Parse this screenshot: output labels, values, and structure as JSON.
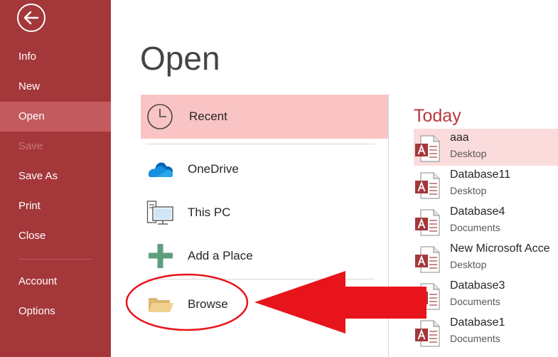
{
  "sidebar": {
    "back_icon": "back-arrow-icon",
    "items": [
      {
        "label": "Info"
      },
      {
        "label": "New"
      },
      {
        "label": "Open",
        "active": true
      },
      {
        "label": "Save",
        "disabled": true
      },
      {
        "label": "Save As"
      },
      {
        "label": "Print"
      },
      {
        "label": "Close"
      }
    ],
    "bottom_items": [
      {
        "label": "Account"
      },
      {
        "label": "Options"
      }
    ]
  },
  "main": {
    "title": "Open",
    "places": [
      {
        "label": "Recent",
        "icon": "clock-icon",
        "selected": true
      },
      {
        "label": "OneDrive",
        "icon": "cloud-icon"
      },
      {
        "label": "This PC",
        "icon": "computer-icon"
      },
      {
        "label": "Add a Place",
        "icon": "plus-icon"
      },
      {
        "label": "Browse",
        "icon": "folder-icon"
      }
    ]
  },
  "recent": {
    "group_label": "Today",
    "files": [
      {
        "name": "aaa",
        "location": "Desktop",
        "selected": true
      },
      {
        "name": "Database11",
        "location": "Desktop"
      },
      {
        "name": "Database4",
        "location": "Documents"
      },
      {
        "name": "New Microsoft Acce",
        "location": "Desktop"
      },
      {
        "name": "Database3",
        "location": "Documents"
      },
      {
        "name": "Database1",
        "location": "Documents"
      }
    ]
  },
  "colors": {
    "sidebar": "#a4373a",
    "sidebar_active": "#c35b5e",
    "selection": "#fac4c4",
    "accent": "#b9373b",
    "annotation": "#e8141c"
  }
}
